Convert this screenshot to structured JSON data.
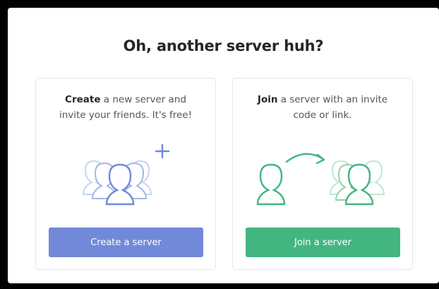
{
  "modal": {
    "title": "Oh, another server huh?"
  },
  "create_card": {
    "highlight": "Create",
    "text_line1_rest": " a new server and",
    "text_line2": "invite your friends. It's free!",
    "button_label": "Create a server",
    "icon": "users-plus-icon",
    "accent_color": "#7289da"
  },
  "join_card": {
    "highlight": "Join",
    "text_line1_rest": " a server with an invite",
    "text_line2": "code or link.",
    "button_label": "Join a server",
    "icon": "user-arrow-group-icon",
    "accent_color": "#43b581"
  }
}
